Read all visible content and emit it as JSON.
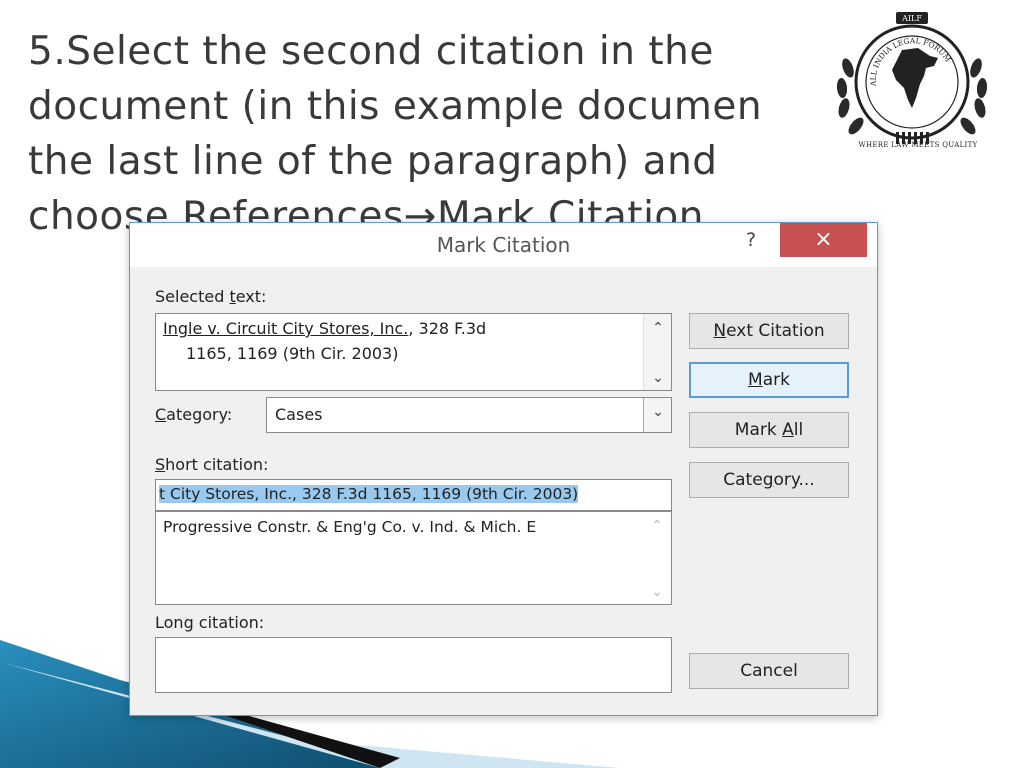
{
  "slide": {
    "title_lines": [
      "5.Select the second citation in the",
      "document (in this example documen",
      "the last line of the paragraph) and",
      "choose References→Mark Citation."
    ]
  },
  "logo": {
    "arc_text": "ALL INDIA LEGAL FORUM",
    "badge": "AILF",
    "tagline": "WHERE LAW MEETS QUALITY"
  },
  "dialog": {
    "title": "Mark Citation",
    "help_label": "?",
    "close_label": "×",
    "selected_text_label": "Selected text:",
    "selected_text_line1_case": "Ingle v. Circuit City Stores, Inc.",
    "selected_text_line1_rest": ", 328 F.3d",
    "selected_text_line2": "1165, 1169 (9th Cir. 2003)",
    "category_label": "Category:",
    "category_value": "Cases",
    "short_citation_label": "Short citation:",
    "short_citation_value": "t City Stores, Inc., 328 F.3d 1165, 1169 (9th Cir. 2003)",
    "short_citation_list": [
      "Progressive Constr. & Eng'g Co. v. Ind. & Mich. E"
    ],
    "long_citation_label": "Long citation:",
    "long_citation_value": "",
    "buttons": {
      "next_citation": "Next Citation",
      "mark": "Mark",
      "mark_all": "Mark All",
      "category": "Category...",
      "cancel": "Cancel"
    }
  },
  "colors": {
    "accent": "#5a9bd5",
    "close_red": "#c75050",
    "selection": "#99c9ef",
    "corner_blue": "#1f6f95"
  }
}
